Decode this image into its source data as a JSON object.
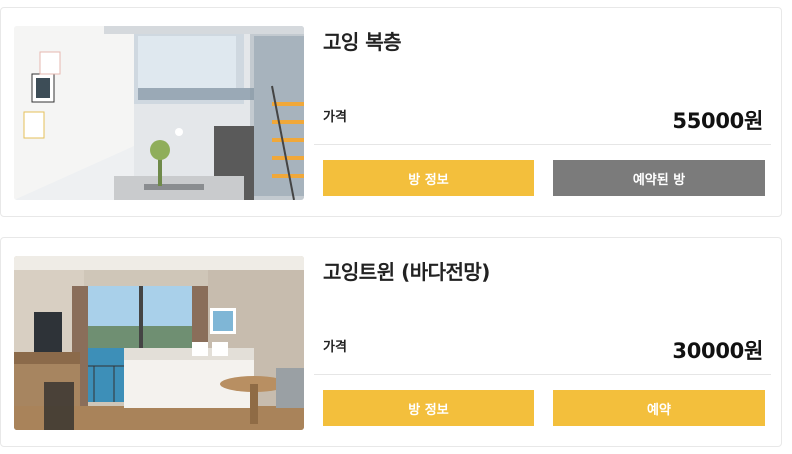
{
  "rooms": [
    {
      "title": "고잉 복층",
      "price_label": "가격",
      "price": "55000원",
      "info_button": "방 정보",
      "action_button": "예약된 방",
      "action_state": "reserved"
    },
    {
      "title": "고잉트윈 (바다전망)",
      "price_label": "가격",
      "price": "30000원",
      "info_button": "방 정보",
      "action_button": "예약",
      "action_state": "available"
    }
  ],
  "colors": {
    "accent": "#f3bf3c",
    "disabled": "#7b7b7b"
  }
}
